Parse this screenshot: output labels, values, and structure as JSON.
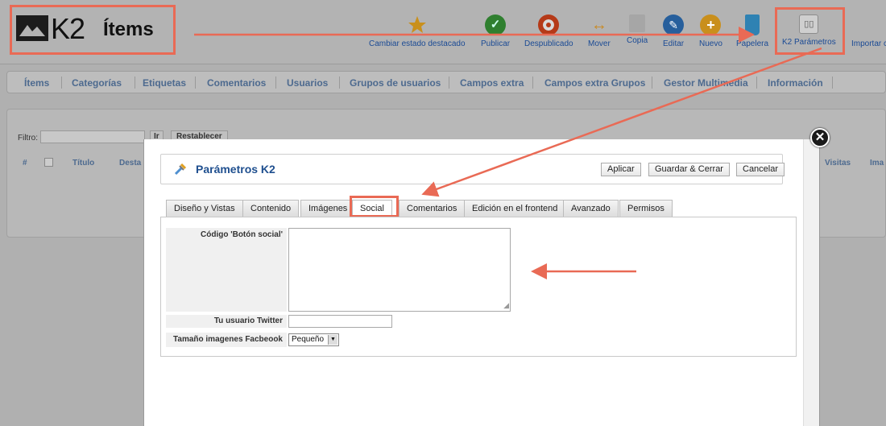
{
  "header": {
    "logo_text": "K2",
    "page_title": "Ítems"
  },
  "toolbar": {
    "buttons": [
      {
        "label": "Cambiar estado destacado",
        "icon": "star-icon",
        "color": "#e3a21a"
      },
      {
        "label": "Publicar",
        "icon": "check-icon",
        "color": "#3a9a3a"
      },
      {
        "label": "Despublicado",
        "icon": "unpublish-icon",
        "color": "#d2461f"
      },
      {
        "label": "Mover",
        "icon": "move-icon",
        "color": "#e39b2e"
      },
      {
        "label": "Copia",
        "icon": "copy-icon",
        "color": "#a0a0a0"
      },
      {
        "label": "Editar",
        "icon": "edit-icon",
        "color": "#2b6cb0"
      },
      {
        "label": "Nuevo",
        "icon": "plus-icon",
        "color": "#e0a21e"
      },
      {
        "label": "Papelera",
        "icon": "trash-icon",
        "color": "#3a94c8"
      },
      {
        "label": "K2 Parámetros",
        "icon": "settings-icon",
        "color": "#8a8a8a"
      },
      {
        "label": "Importar c",
        "icon": "",
        "color": ""
      }
    ]
  },
  "subnav": {
    "items": [
      "Ítems",
      "Categorías",
      "Etiquetas",
      "Comentarios",
      "Usuarios",
      "Grupos de usuarios",
      "Campos extra",
      "Campos extra Grupos",
      "Gestor Multimedia",
      "Información"
    ]
  },
  "filter": {
    "label": "Filtro:",
    "go_label": "Ir",
    "reset_label": "Restablecer"
  },
  "list_columns": [
    "#",
    "Título",
    "Desta",
    "Visitas",
    "Ima"
  ],
  "modal": {
    "title": "Parámetros K2",
    "buttons": {
      "apply": "Aplicar",
      "save_close": "Guardar & Cerrar",
      "cancel": "Cancelar"
    },
    "tabs": [
      "Diseño y Vistas",
      "Contenido",
      "Imágenes",
      "Social",
      "Comentarios",
      "Edición en el frontend",
      "Avanzado",
      "Permisos"
    ],
    "active_tab": "Social",
    "fields": {
      "social_button_label": "Código 'Botón social'",
      "social_button_value": "",
      "twitter_label": "Tu usuario Twitter",
      "twitter_value": "",
      "fb_image_label": "Tamaño imagenes Facbeook",
      "fb_image_value": "Pequeño"
    }
  },
  "annotation_color": "#e96a55"
}
